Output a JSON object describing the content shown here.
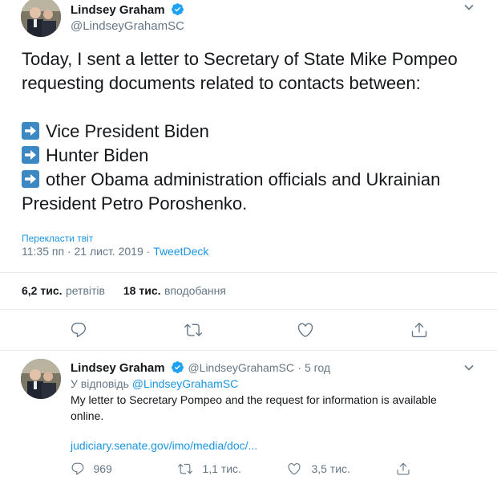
{
  "main_tweet": {
    "author_name": "Lindsey Graham",
    "author_handle": "@LindseyGrahamSC",
    "text_intro": "Today, I sent a letter to Secretary of State Mike Pompeo requesting documents related to contacts between:",
    "bullets": [
      "Vice President Biden",
      "Hunter Biden",
      "other Obama administration officials and Ukrainian President Petro Poroshenko."
    ],
    "translate_label": "Перекласти твіт",
    "timestamp": "11:35 пп · 21 лист. 2019 · ",
    "source": "TweetDeck",
    "retweets_count": "6,2 тис.",
    "retweets_label": "ретвітів",
    "likes_count": "18 тис.",
    "likes_label": "вподобання"
  },
  "reply_tweet": {
    "author_name": "Lindsey Graham",
    "author_handle": "@LindseyGrahamSC",
    "time": "· 5 год",
    "reply_prefix": "У відповідь ",
    "reply_to": "@LindseyGrahamSC",
    "text": "My letter to Secretary Pompeo and the request for information is available online.",
    "link": "judiciary.senate.gov/imo/media/doc/...",
    "reply_count": "969",
    "retweet_count": "1,1 тис.",
    "like_count": "3,5 тис."
  },
  "colors": {
    "accent": "#1b95e0",
    "verified": "#1da1f2",
    "secondary_text": "#657786",
    "arrow_box": "#3b88c3"
  },
  "icons": [
    "verified-badge-icon",
    "chevron-down-icon",
    "arrow-right-icon",
    "reply-icon",
    "retweet-icon",
    "like-icon",
    "share-icon"
  ]
}
